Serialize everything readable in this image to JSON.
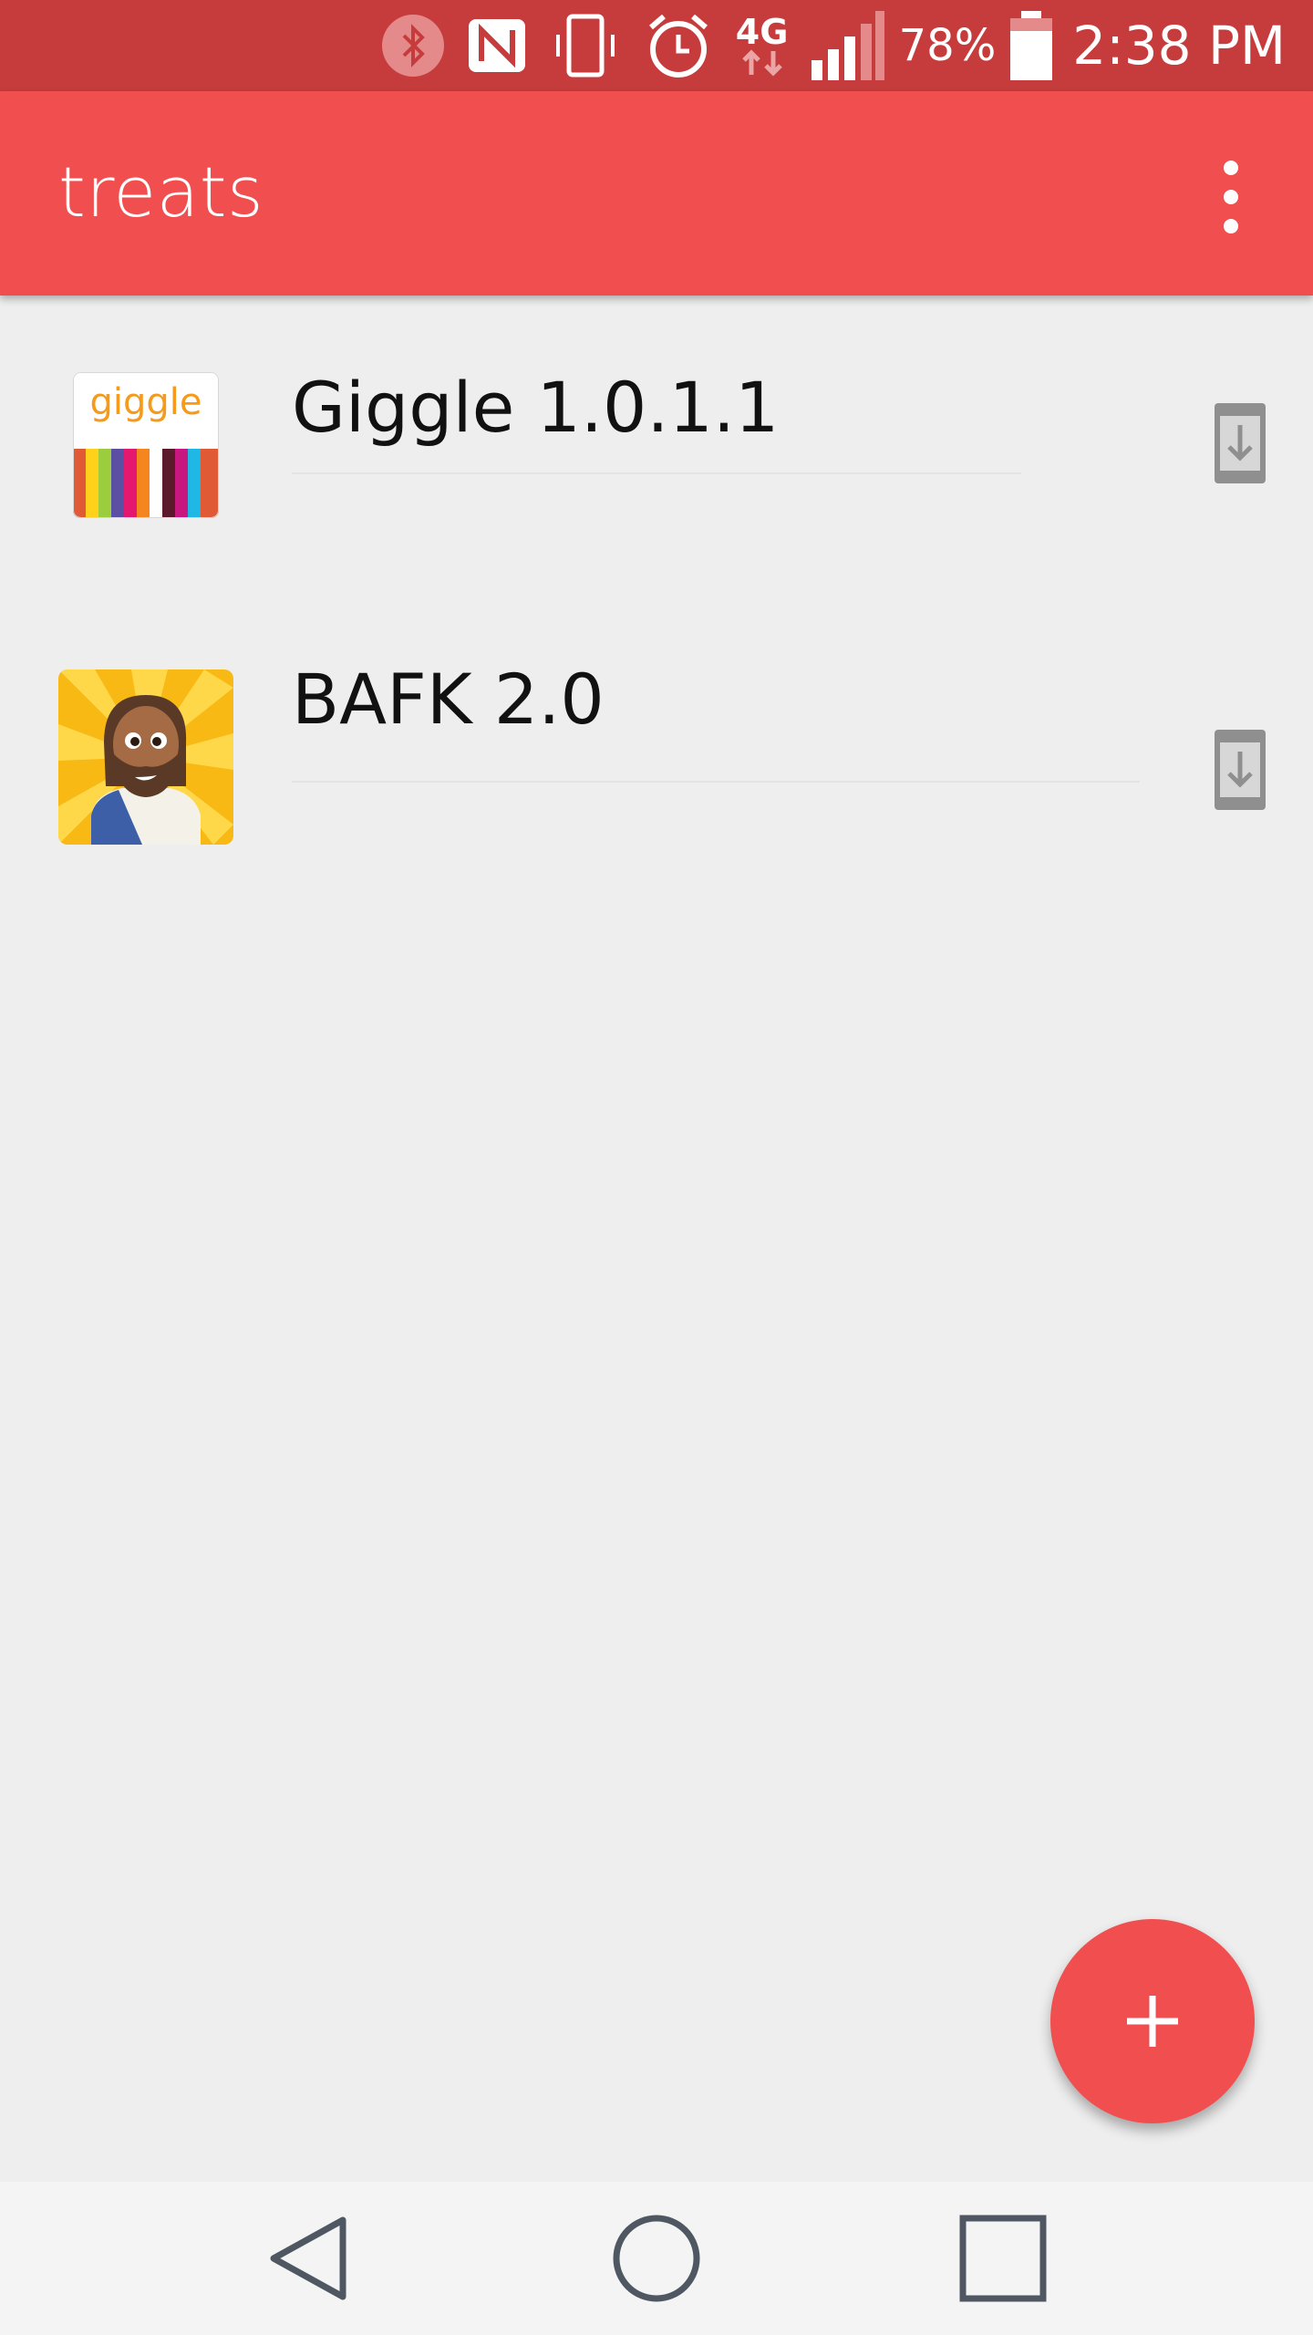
{
  "status_bar": {
    "battery": "78%",
    "time": "2:38 PM",
    "network": "4G"
  },
  "app_bar": {
    "title": "treats"
  },
  "apps": [
    {
      "name": "Giggle 1.0.1.1",
      "icon_text": "giggle"
    },
    {
      "name": "BAFK 2.0"
    }
  ],
  "colors": {
    "accent": "#f14f4f",
    "status_bar": "#c63c3c",
    "background": "#eeeeee"
  }
}
